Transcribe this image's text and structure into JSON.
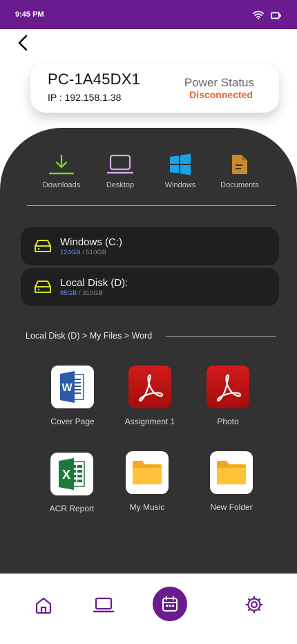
{
  "status_bar": {
    "time": "9:45 PM"
  },
  "pc": {
    "name": "PC-1A45DX1",
    "ip": "IP : 192.158.1.38",
    "power_label": "Power Status",
    "power_status": "Disconnected",
    "power_status_color": "#e8622a"
  },
  "quick_access": [
    {
      "label": "Downloads",
      "icon": "download-icon"
    },
    {
      "label": "Desktop",
      "icon": "laptop-icon"
    },
    {
      "label": "Windows",
      "icon": "windows-icon"
    },
    {
      "label": "Documents",
      "icon": "document-icon"
    }
  ],
  "drives": [
    {
      "name": "Windows (C:)",
      "used": "124GB",
      "total": " / 510GB"
    },
    {
      "name": "Local Disk (D):",
      "used": "85GB",
      "total": " / 310GB"
    }
  ],
  "breadcrumb": "Local Disk (D) > My Files > Word",
  "files": [
    {
      "label": "Cover Page",
      "icon": "word-icon"
    },
    {
      "label": "Assignment 1",
      "icon": "pdf-icon"
    },
    {
      "label": "Photo",
      "icon": "pdf-icon"
    },
    {
      "label": "ACR Report",
      "icon": "excel-icon"
    },
    {
      "label": "My Music",
      "icon": "folder-icon"
    },
    {
      "label": "New Folder",
      "icon": "folder-icon"
    }
  ],
  "bottom_nav": [
    "home-icon",
    "laptop-icon",
    "calendar-icon",
    "settings-icon"
  ],
  "colors": {
    "brand": "#6a1b8e",
    "panel": "#323232",
    "drive_card": "#1f1f1f",
    "used_text": "#6e8fe0"
  }
}
